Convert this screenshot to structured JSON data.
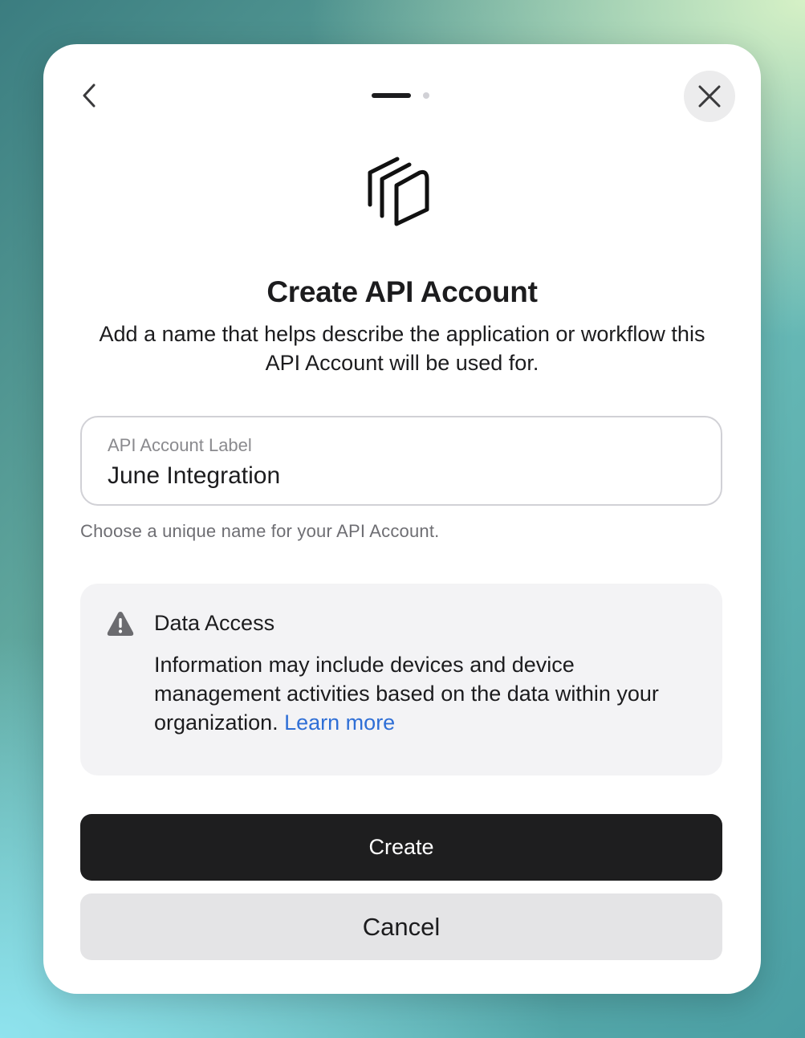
{
  "dialog": {
    "title": "Create API Account",
    "subtitle": "Add a name that helps describe the application or workflow this API Account will be used for.",
    "back_icon": "chevron-left-icon",
    "close_icon": "close-icon",
    "app_icon": "stacked-cards-icon",
    "pager": {
      "total_pages": 2,
      "current_page": 1
    }
  },
  "field": {
    "label": "API Account Label",
    "value": "June Integration",
    "hint": "Choose a unique name for your API Account."
  },
  "info": {
    "icon": "warning-icon",
    "title": "Data Access",
    "body": "Information may include devices and device management activities based on the data within your organization.",
    "link_label": "Learn more"
  },
  "actions": {
    "create_label": "Create",
    "cancel_label": "Cancel"
  },
  "colors": {
    "primary_button": "#1e1e1f",
    "secondary_button": "#e4e4e6",
    "link": "#2f6fd6",
    "info_background": "#f3f3f5"
  }
}
